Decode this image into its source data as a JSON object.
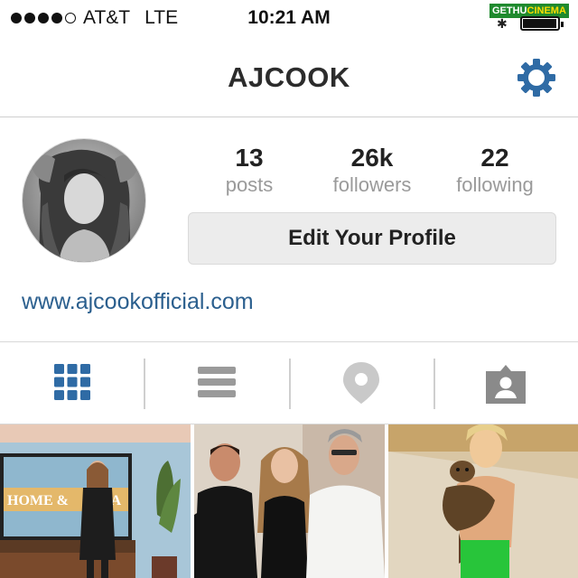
{
  "status_bar": {
    "signal": "●●●●○",
    "carrier": "AT&T",
    "network": "LTE",
    "time": "10:21 AM",
    "watermark_a": "GETHU",
    "watermark_b": "CINEMA",
    "bluetooth_icon": "bluetooth-icon",
    "battery_level": 0.97
  },
  "header": {
    "title": "AJCOOK",
    "settings_icon": "gear-icon"
  },
  "profile": {
    "avatar": "profile-photo",
    "stats": {
      "posts": {
        "value": "13",
        "label": "posts"
      },
      "followers": {
        "value": "26k",
        "label": "followers"
      },
      "following": {
        "value": "22",
        "label": "following"
      }
    },
    "edit_button_label": "Edit Your Profile",
    "website": "www.ajcookofficial.com"
  },
  "tabs": [
    {
      "icon": "grid-icon",
      "active": true
    },
    {
      "icon": "list-icon",
      "active": false
    },
    {
      "icon": "location-pin-icon",
      "active": false
    },
    {
      "icon": "tagged-photos-icon",
      "active": false
    }
  ],
  "photos": [
    {
      "sign_text_a": "HOME &",
      "sign_text_b": "FA"
    },
    {
      "description_icon": "group-photo"
    },
    {
      "description_icon": "child-with-dog-photo"
    }
  ],
  "colors": {
    "accent": "#2f6ba5",
    "icon_inactive": "#9a9a9a",
    "link": "#2b5f8e",
    "button_bg": "#ececec"
  }
}
